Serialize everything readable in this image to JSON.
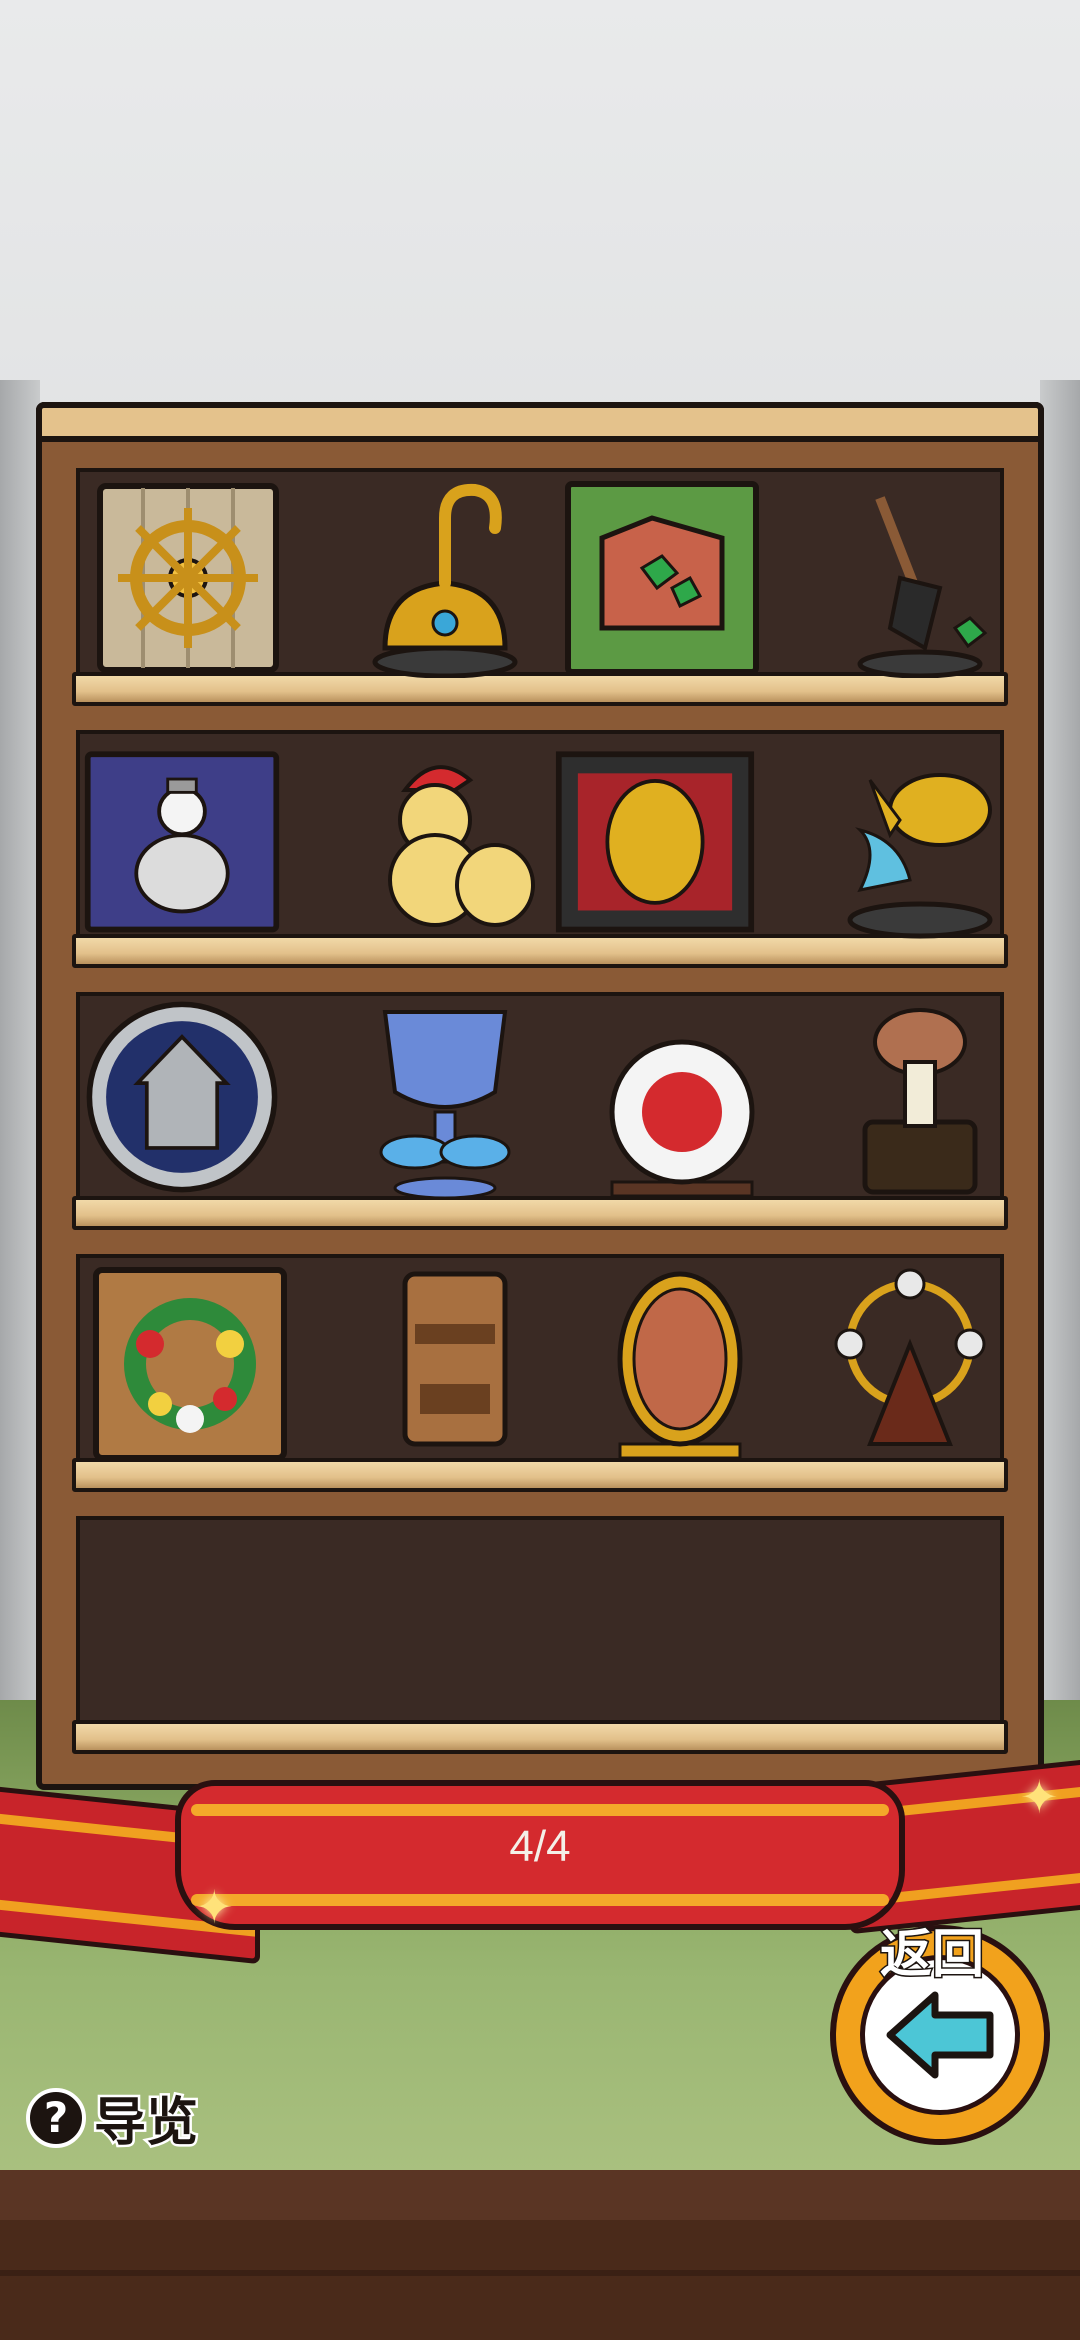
{
  "pagination": {
    "current_page": "4/4"
  },
  "back_button": {
    "label": "返回"
  },
  "guide_button": {
    "label": "导览",
    "icon": "question-icon"
  },
  "shelves": [
    {
      "items": [
        "ship-wheel-plaque-icon",
        "golden-hook-trophy-icon",
        "green-gem-plaque-icon",
        "shovel-trophy-icon"
      ]
    },
    {
      "items": [
        "snowman-plaque-icon",
        "santa-statue-icon",
        "gold-coin-frame-icon",
        "golden-fish-trophy-icon"
      ]
    },
    {
      "items": [
        "house-medallion-icon",
        "crystal-goblet-icon",
        "red-plate-display-icon",
        "mushroom-statue-icon"
      ]
    },
    {
      "items": [
        "flower-wreath-plaque-icon",
        "tiki-statue-icon",
        "copper-medal-stand-icon",
        "ferris-wheel-trophy-icon"
      ]
    },
    {
      "items": []
    }
  ],
  "colors": {
    "ribbon": "#d42a2e",
    "ribbon_stripe": "#f4a82a",
    "shelf_wood": "#8a5a36",
    "back_button": "#f2a21c",
    "back_arrow": "#4cc6d6"
  }
}
